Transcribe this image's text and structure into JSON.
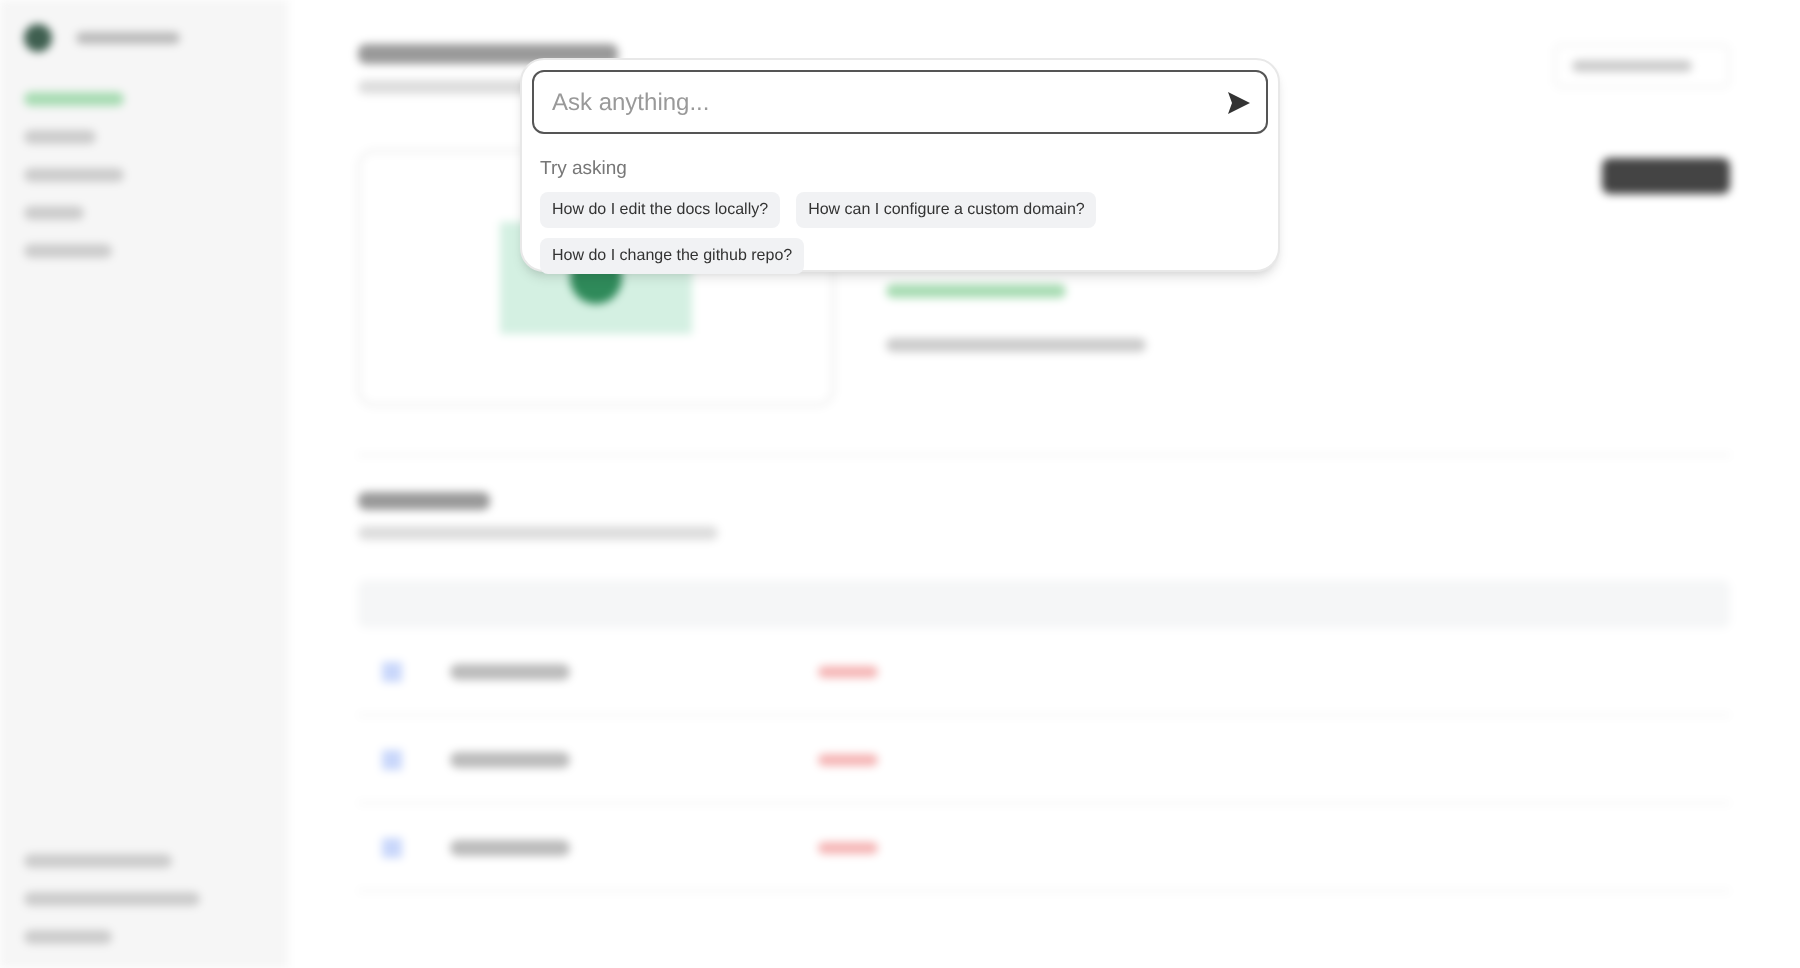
{
  "search": {
    "placeholder": "Ask anything..."
  },
  "suggestions": {
    "heading": "Try asking",
    "items": [
      "How do I edit the docs locally?",
      "How can I configure a custom domain?",
      "How do I change the github repo?"
    ]
  }
}
